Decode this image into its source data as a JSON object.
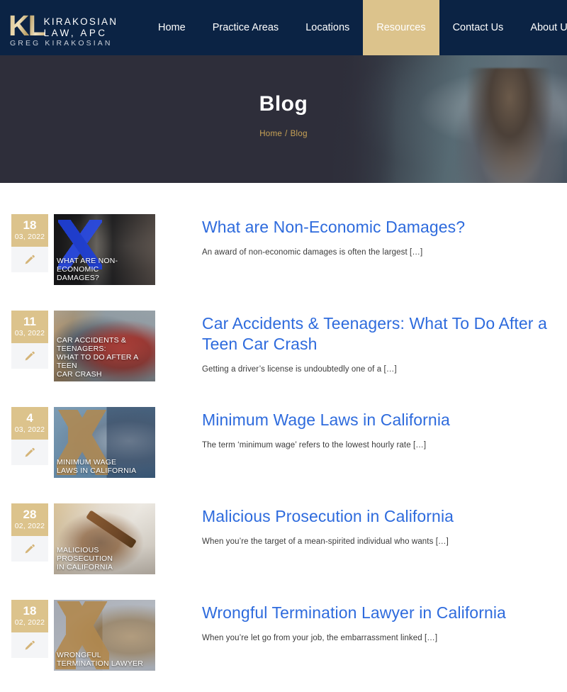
{
  "header": {
    "logo": {
      "mark": "KL",
      "line1": "KIRAKOSIAN",
      "line2": "LAW, APC",
      "subtitle": "GREG KIRAKOSIAN"
    },
    "nav_items": [
      {
        "label": "Home",
        "active": false
      },
      {
        "label": "Practice Areas",
        "active": false
      },
      {
        "label": "Locations",
        "active": false
      },
      {
        "label": "Resources",
        "active": true
      },
      {
        "label": "Contact Us",
        "active": false
      },
      {
        "label": "About Us",
        "active": false
      }
    ],
    "search_icon": "search-icon",
    "background_color": "#0b2344",
    "active_item_color": "#dcc38c"
  },
  "hero": {
    "title": "Blog",
    "breadcrumb": {
      "home_label": "Home",
      "separator": "/",
      "current_label": "Blog"
    },
    "background_color": "#2e2e3a",
    "breadcrumb_color": "#c9a356"
  },
  "blog": {
    "posts": [
      {
        "date": {
          "day": "18",
          "month_year": "03, 2022"
        },
        "icon": "pen-icon",
        "thumbnail_caption": "WHAT ARE NON-ECONOMIC\nDAMAGES?",
        "title": "What are Non-Economic Damages?",
        "excerpt": "An award of non-economic damages is often the largest […]"
      },
      {
        "date": {
          "day": "11",
          "month_year": "03, 2022"
        },
        "icon": "pen-icon",
        "thumbnail_caption": "CAR ACCIDENTS & TEENAGERS:\nWHAT TO DO AFTER A TEEN\nCAR CRASH",
        "title": "Car Accidents & Teenagers: What To Do After a Teen Car Crash",
        "excerpt": "Getting a driver’s license is undoubtedly one of a […]"
      },
      {
        "date": {
          "day": "4",
          "month_year": "03, 2022"
        },
        "icon": "pen-icon",
        "thumbnail_caption": "MINIMUM WAGE\nLAWS IN CALIFORNIA",
        "title": "Minimum Wage Laws in California",
        "excerpt": "The term ‘minimum wage’ refers to the lowest hourly rate […]"
      },
      {
        "date": {
          "day": "28",
          "month_year": "02, 2022"
        },
        "icon": "pen-icon",
        "thumbnail_caption": "MALICIOUS PROSECUTION\nIN CALIFORNIA",
        "title": "Malicious Prosecution in California",
        "excerpt": "When you’re the target of a mean-spirited individual who wants […]"
      },
      {
        "date": {
          "day": "18",
          "month_year": "02, 2022"
        },
        "icon": "pen-icon",
        "thumbnail_caption": "WRONGFUL\nTERMINATION LAWYER",
        "title": "Wrongful Termination Lawyer in California",
        "excerpt": "When you’re let go from your job, the embarrassment linked […]"
      }
    ],
    "title_color": "#2e6bdd",
    "date_badge_color": "#dcc38c"
  }
}
